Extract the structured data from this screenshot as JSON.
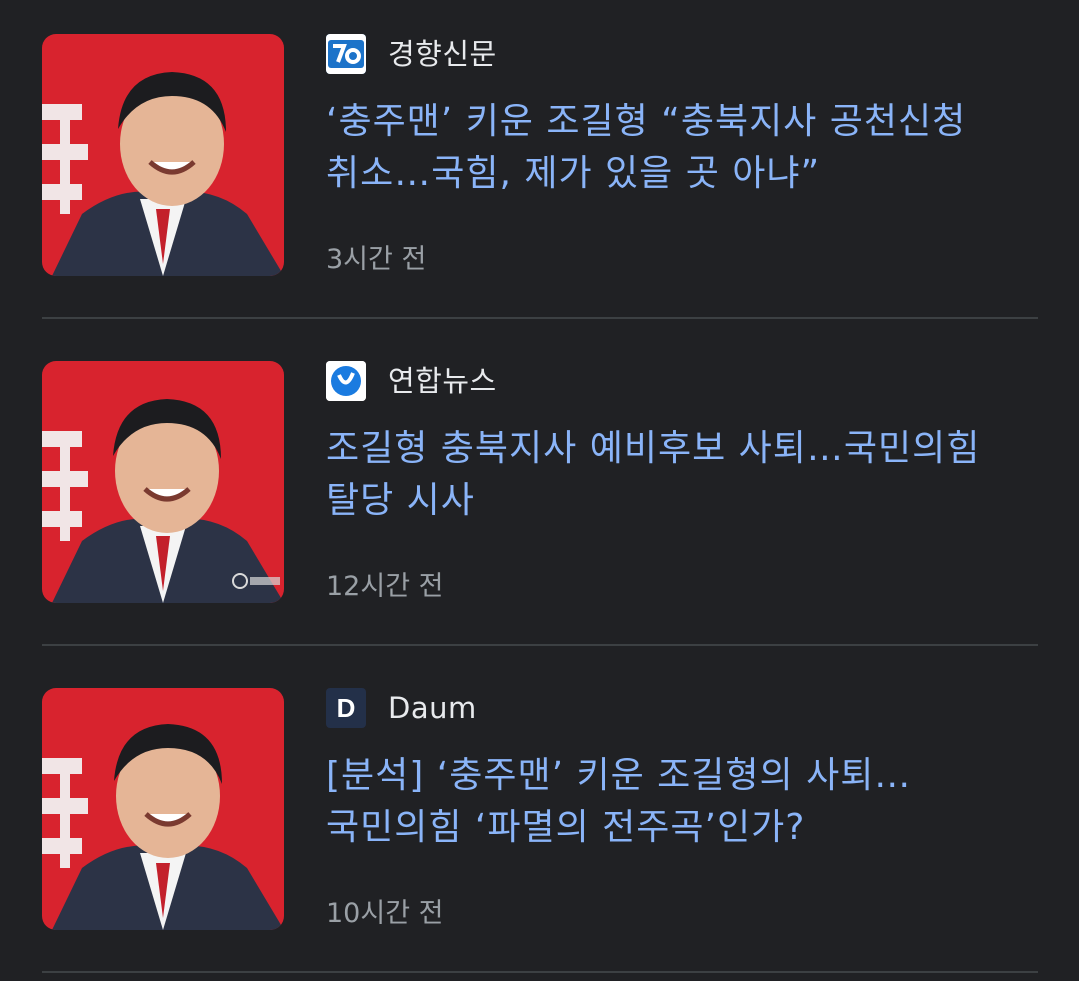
{
  "articles": [
    {
      "source": "경향신문",
      "logo_icon": "kyunghyang-logo-icon",
      "headline": "‘충주맨’ 키운 조길형 “충북지사 공천신청 취소…국힘, 제가 있을 곳 아냐”",
      "time": "3시간 전"
    },
    {
      "source": "연합뉴스",
      "logo_icon": "yonhap-logo-icon",
      "headline": "조길형 충북지사 예비후보 사퇴…국민의힘 탈당 시사",
      "time": "12시간 전"
    },
    {
      "source": "Daum",
      "logo_icon": "daum-logo-icon",
      "logo_letter": "D",
      "headline": "[분석] ‘충주맨’ 키운 조길형의 사퇴… 국민의힘 ‘파멸의 전주곡’인가?",
      "time": "10시간 전"
    }
  ],
  "colors": {
    "background": "#202124",
    "headline": "#8ab4f8",
    "source": "#e8eaed",
    "time": "#9aa0a6",
    "divider": "#3c4043"
  }
}
